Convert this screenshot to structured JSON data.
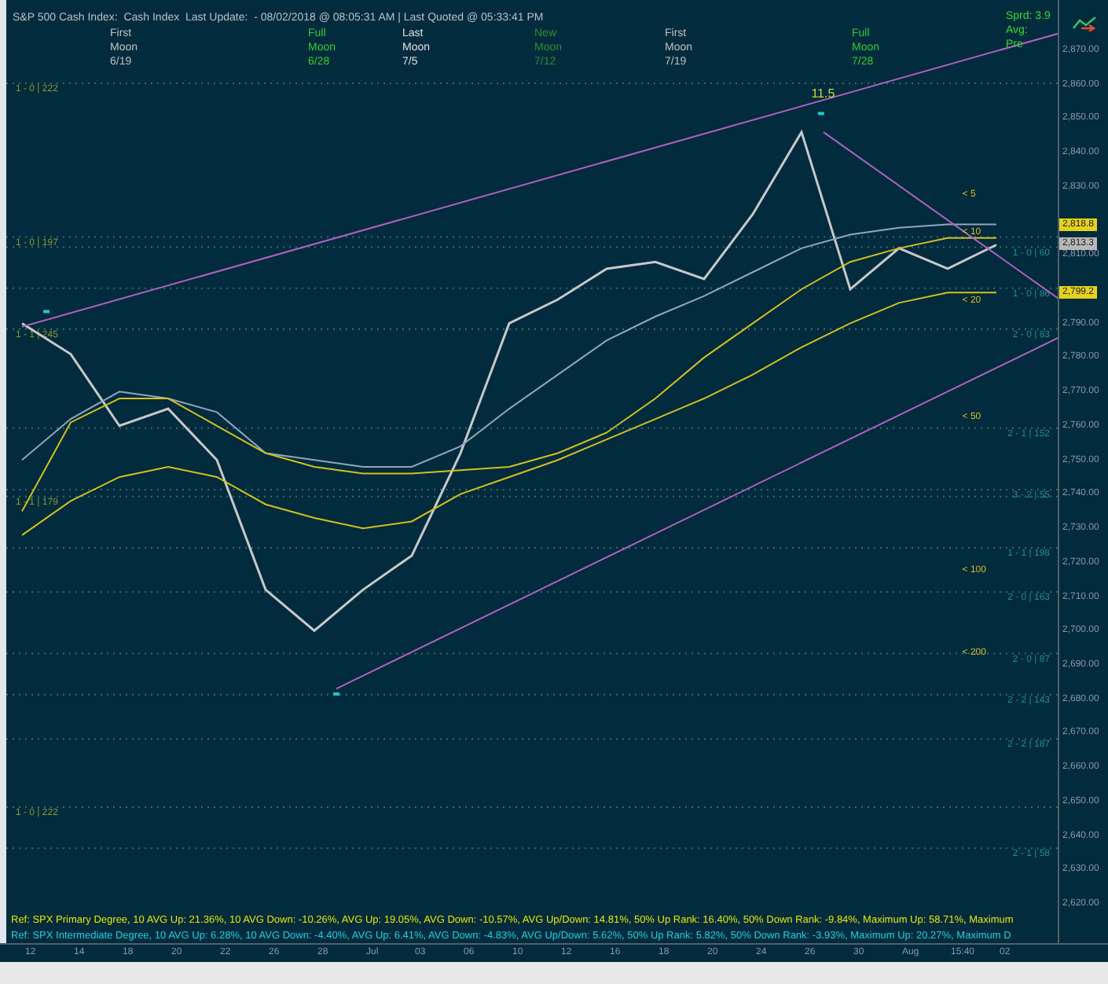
{
  "header": {
    "title": "S&P 500 Cash Index:  Cash Index  Last Update:  - 08/02/2018 @ 08:05:31 AM | Last Quoted @ 05:33:41 PM",
    "moon_phases": [
      {
        "lines": [
          "First",
          "Moon",
          "6/19"
        ],
        "color": "#c0c0c0"
      },
      {
        "lines": [
          "Full",
          "Moon",
          "6/28"
        ],
        "color": "#33cc33"
      },
      {
        "lines": [
          "Last",
          "Moon",
          "7/5"
        ],
        "color": "#e0e0e0"
      },
      {
        "lines": [
          "New",
          "Moon",
          "7/12"
        ],
        "color": "#2f8f2f"
      },
      {
        "lines": [
          "First",
          "Moon",
          "7/19"
        ],
        "color": "#c0c0c0"
      },
      {
        "lines": [
          "Full",
          "Moon",
          "7/28"
        ],
        "color": "#33cc33"
      }
    ],
    "stats": [
      "Sprd: 3.9",
      "Avg:",
      "Pre"
    ]
  },
  "chart": {
    "chart_data": {
      "type": "line",
      "categories": [
        "12",
        "14",
        "18",
        "20",
        "22",
        "26",
        "28",
        "Jul",
        "03",
        "06",
        "10",
        "12",
        "16",
        "18",
        "20",
        "24",
        "26",
        "30",
        "Aug",
        "15:40",
        "02"
      ],
      "ylim": [
        2608.5,
        2884.7
      ],
      "grid": true,
      "yticks": [
        {
          "value": 2620,
          "label": "2,620.00"
        },
        {
          "value": 2630,
          "label": "2,630.00"
        },
        {
          "value": 2640,
          "label": "2,640.00"
        },
        {
          "value": 2650,
          "label": "2,650.00"
        },
        {
          "value": 2660,
          "label": "2,660.00"
        },
        {
          "value": 2670,
          "label": "2,670.00"
        },
        {
          "value": 2680,
          "label": "2,680.00"
        },
        {
          "value": 2690,
          "label": "2,690.00"
        },
        {
          "value": 2700,
          "label": "2,700.00"
        },
        {
          "value": 2710,
          "label": "2,710.00"
        },
        {
          "value": 2720,
          "label": "2,720.00"
        },
        {
          "value": 2730,
          "label": "2,730.00"
        },
        {
          "value": 2740,
          "label": "2,740.00"
        },
        {
          "value": 2750,
          "label": "2,750.00"
        },
        {
          "value": 2760,
          "label": "2,760.00"
        },
        {
          "value": 2770,
          "label": "2,770.00"
        },
        {
          "value": 2780,
          "label": "2,780.00"
        },
        {
          "value": 2790,
          "label": "2,790.00"
        },
        {
          "value": 2810,
          "label": "2,810.00"
        },
        {
          "value": 2830,
          "label": "2,830.00"
        },
        {
          "value": 2840,
          "label": "2,840.00"
        },
        {
          "value": 2850,
          "label": "2,850.00"
        },
        {
          "value": 2860,
          "label": "2,860.00"
        },
        {
          "value": 2870,
          "label": "2,870.00"
        }
      ],
      "series": [
        {
          "color": "#c8c8c8",
          "values": [
            2790,
            2781,
            2760,
            2765,
            2750,
            2712,
            2700,
            2712,
            2722,
            2752,
            2790,
            2797,
            2806,
            2808,
            2803,
            2822,
            2846,
            2800,
            2812,
            2806,
            2813
          ]
        },
        {
          "color": "#8fa8c0",
          "values": [
            2750,
            2762,
            2770,
            2768,
            2764,
            2752,
            2750,
            2748,
            2748,
            2754,
            2765,
            2775,
            2785,
            2792,
            2798,
            2805,
            2812,
            2816,
            2818,
            2819,
            2819
          ]
        },
        {
          "color": "#d4c020",
          "values": [
            2735,
            2761,
            2768,
            2768,
            2760,
            2752,
            2748,
            2746,
            2746,
            2747,
            2748,
            2752,
            2758,
            2768,
            2780,
            2790,
            2800,
            2808,
            2812,
            2815,
            2815
          ]
        },
        {
          "color": "#d4c020",
          "values": [
            2728,
            2738,
            2745,
            2748,
            2745,
            2737,
            2733,
            2730,
            2732,
            2740,
            2745,
            2750,
            2756,
            2762,
            2768,
            2775,
            2783,
            2790,
            2796,
            2799,
            2799
          ]
        }
      ],
      "annotations": [
        "11.5",
        "< 5",
        "< 10",
        "< 20",
        "< 50",
        "< 100",
        "< 200"
      ]
    },
    "level_labels": [
      {
        "text": "1 - 0 | 222",
        "color": "#8a9a30"
      },
      {
        "text": "1 - 0 | 197",
        "color": "#8a9a30"
      },
      {
        "text": "1 - 1 | 245",
        "color": "#8a9a30"
      },
      {
        "text": "1 - 1 | 179",
        "color": "#8a9a30"
      },
      {
        "text": "1 - 0 | 222",
        "color": "#8a9a30"
      },
      {
        "text": "1 - 0 | 60",
        "color": "#1f8f8f"
      },
      {
        "text": "1 - 0 | 86",
        "color": "#1f8f8f"
      },
      {
        "text": "2 - 0 | 83",
        "color": "#1f8f8f"
      },
      {
        "text": "2 - 1 | 152",
        "color": "#1f8f8f"
      },
      {
        "text": "3 - 2 | 55",
        "color": "#1f8f8f"
      },
      {
        "text": "1 - 1 | 198",
        "color": "#1f8f8f"
      },
      {
        "text": "2 - 0 | 163",
        "color": "#1f8f8f"
      },
      {
        "text": "2 - 0 | 87",
        "color": "#1f8f8f"
      },
      {
        "text": "2 - 2 | 143",
        "color": "#1f8f8f"
      },
      {
        "text": "2 - 2 | 187",
        "color": "#1f8f8f"
      },
      {
        "text": "2 - 1 | 58",
        "color": "#1f8f8f"
      }
    ],
    "price_tags": [
      {
        "text": "2,818.8",
        "color": "#e6d21a"
      },
      {
        "text": "2,813.3",
        "color": "#b8b8b8"
      },
      {
        "text": "2,799.2",
        "color": "#e6d21a"
      }
    ]
  },
  "footer_lines": [
    "Ref: SPX Primary Degree, 10 AVG Up: 21.36%, 10 AVG Down: -10.26%, AVG Up: 19.05%, AVG Down: -10.57%, AVG Up/Down: 14.81%, 50%  Up Rank: 16.40%, 50% Down Rank: -9.84%, Maximum Up: 58.71%, Maximum",
    "Ref: SPX Intermediate Degree, 10 AVG Up: 6.28%, 10 AVG Down: -4.40%, AVG Up: 6.41%, AVG Down: -4.83%, AVG Up/Down: 5.62%, 50%  Up Rank: 5.82%, 50% Down Rank: -3.93%, Maximum Up: 20.27%, Maximum D"
  ]
}
